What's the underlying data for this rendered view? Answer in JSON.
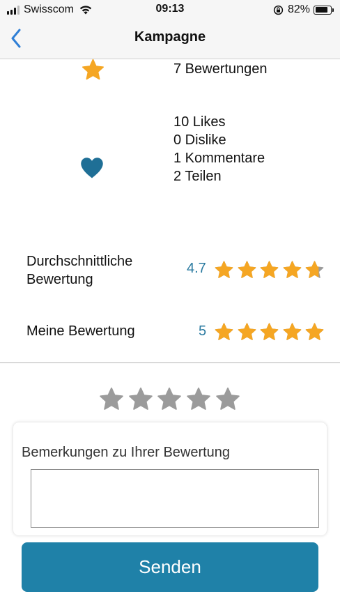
{
  "status_bar": {
    "carrier": "Swisscom",
    "time": "09:13",
    "battery_percent": "82%",
    "battery_level": 0.82,
    "signal_bars_active": 3
  },
  "nav": {
    "title": "Kampagne",
    "back_icon": "chevron-left-icon"
  },
  "summary": {
    "ratings_count": "7 Bewertungen",
    "stats": [
      "10 Likes",
      "0 Dislike",
      "1 Kommentare",
      "2 Teilen"
    ]
  },
  "average_rating": {
    "label": "Durchschnittliche Bewertung",
    "value": "4.7",
    "stars": 4.7
  },
  "my_rating": {
    "label": "Meine Bewertung",
    "value": "5",
    "stars": 5
  },
  "rating_input": {
    "stars": 0,
    "max": 5
  },
  "remarks": {
    "label": "Bemerkungen zu Ihrer Bewertung",
    "value": ""
  },
  "send_button": {
    "label": "Senden"
  },
  "colors": {
    "star_filled": "#f5a623",
    "star_empty": "#9b9b9b",
    "heart": "#1f6f96",
    "accent_value": "#2a7aa0",
    "button": "#1f81a8",
    "back_chevron": "#2f7fd6"
  }
}
